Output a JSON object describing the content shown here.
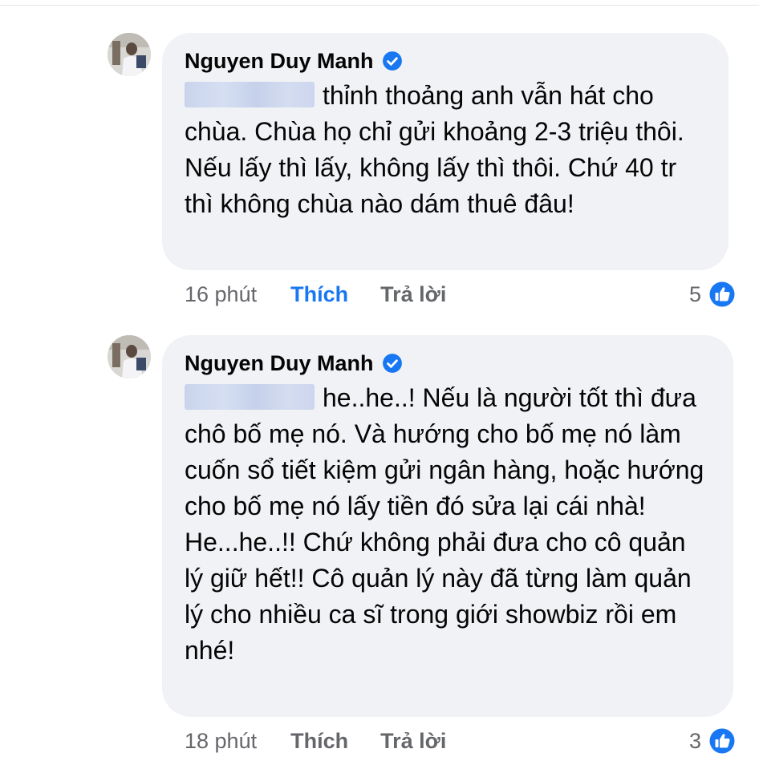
{
  "comments": [
    {
      "author": "Nguyen Duy Manh",
      "text": "thỉnh thoảng anh vẫn hát cho chùa. Chùa họ chỉ gửi khoảng 2-3 triệu thôi. Nếu lấy thì lấy, không lấy thì thôi. Chứ 40 tr thì không chùa nào dám thuê đâu!",
      "time": "16 phút",
      "like_label": "Thích",
      "like_active": true,
      "reply_label": "Trả lời",
      "reaction_count": "5"
    },
    {
      "author": "Nguyen Duy Manh",
      "text": "he..he..! Nếu là người tốt thì đưa chô bố mẹ nó. Và hướng cho bố mẹ nó làm cuốn sổ tiết kiệm gửi ngân hàng, hoặc hướng cho bố mẹ nó lấy tiền đó sửa lại cái nhà! He...he..!! Chứ không phải đưa cho cô quản lý giữ hết!! Cô quản lý này đã từng làm quản lý cho nhiều ca sĩ trong giới showbiz rồi em nhé!",
      "time": "18 phút",
      "like_label": "Thích",
      "like_active": false,
      "reply_label": "Trả lời",
      "reaction_count": "3"
    }
  ],
  "colors": {
    "bubble": "#f0f2f5",
    "like_active": "#1877f2",
    "muted": "#65676b",
    "verified": "#1877f2"
  },
  "icons": {
    "verified": "verified-badge-icon",
    "reaction": "like-reaction-icon"
  }
}
